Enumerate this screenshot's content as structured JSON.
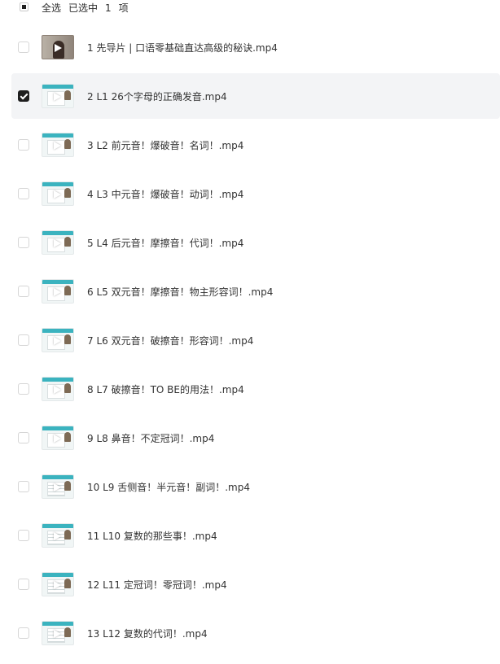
{
  "header": {
    "select_all_label": "全选",
    "selected_prefix": "已选中",
    "selected_count": "1",
    "selected_unit": "项"
  },
  "files": [
    {
      "name": "1 先导片 | 口语零基础直达高级的秘诀.mp4",
      "selected": false,
      "thumb": "person-video-thumbnail"
    },
    {
      "name": "2 L1 26个字母的正确发音.mp4",
      "selected": true,
      "thumb": "slide-video-thumbnail"
    },
    {
      "name": "3 L2 前元音！爆破音！名词！.mp4",
      "selected": false,
      "thumb": "slide-video-thumbnail"
    },
    {
      "name": "4 L3 中元音！爆破音！动词！.mp4",
      "selected": false,
      "thumb": "slide-video-thumbnail"
    },
    {
      "name": "5 L4 后元音！摩擦音！代词！.mp4",
      "selected": false,
      "thumb": "slide-video-thumbnail"
    },
    {
      "name": "6 L5 双元音！摩擦音！物主形容词！.mp4",
      "selected": false,
      "thumb": "slide-video-thumbnail"
    },
    {
      "name": "7 L6 双元音！破擦音！形容词！.mp4",
      "selected": false,
      "thumb": "slide-video-thumbnail"
    },
    {
      "name": "8 L7 破擦音！TO BE的用法！.mp4",
      "selected": false,
      "thumb": "slide-video-thumbnail"
    },
    {
      "name": "9 L8 鼻音！不定冠词！.mp4",
      "selected": false,
      "thumb": "slide-video-thumbnail"
    },
    {
      "name": "10 L9 舌侧音！半元音！副词！.mp4",
      "selected": false,
      "thumb": "slide-video-thumbnail"
    },
    {
      "name": "11 L10 复数的那些事！.mp4",
      "selected": false,
      "thumb": "slide-video-thumbnail"
    },
    {
      "name": "12 L11 定冠词！零冠词！.mp4",
      "selected": false,
      "thumb": "slide-video-thumbnail"
    },
    {
      "name": "13 L12 复数的代词！.mp4",
      "selected": false,
      "thumb": "slide-video-thumbnail"
    }
  ]
}
